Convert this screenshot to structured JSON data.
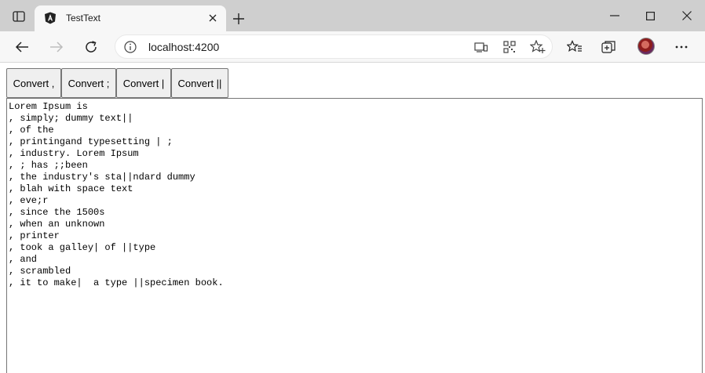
{
  "browser": {
    "tab": {
      "title": "TestText",
      "favicon": "angular-icon"
    },
    "address": {
      "url": "localhost:4200"
    }
  },
  "page": {
    "buttons": [
      {
        "label": "Convert ,"
      },
      {
        "label": "Convert ;"
      },
      {
        "label": "Convert |"
      },
      {
        "label": "Convert ||"
      }
    ],
    "textarea": {
      "value": "Lorem Ipsum is\n, simply; dummy text||\n, of the\n, printingand typesetting | ;\n, industry. Lorem Ipsum\n, ; has ;;been\n, the industry's sta||ndard dummy\n, blah with space text\n, eve;r\n, since the 1500s\n, when an unknown\n, printer\n, took a galley| of ||type\n, and\n, scrambled\n, it to make|  a type ||specimen book."
    }
  },
  "colors": {
    "titlebar": "#cfcfcf",
    "toolbar": "#f7f7f7",
    "button_bg": "#efefef"
  }
}
